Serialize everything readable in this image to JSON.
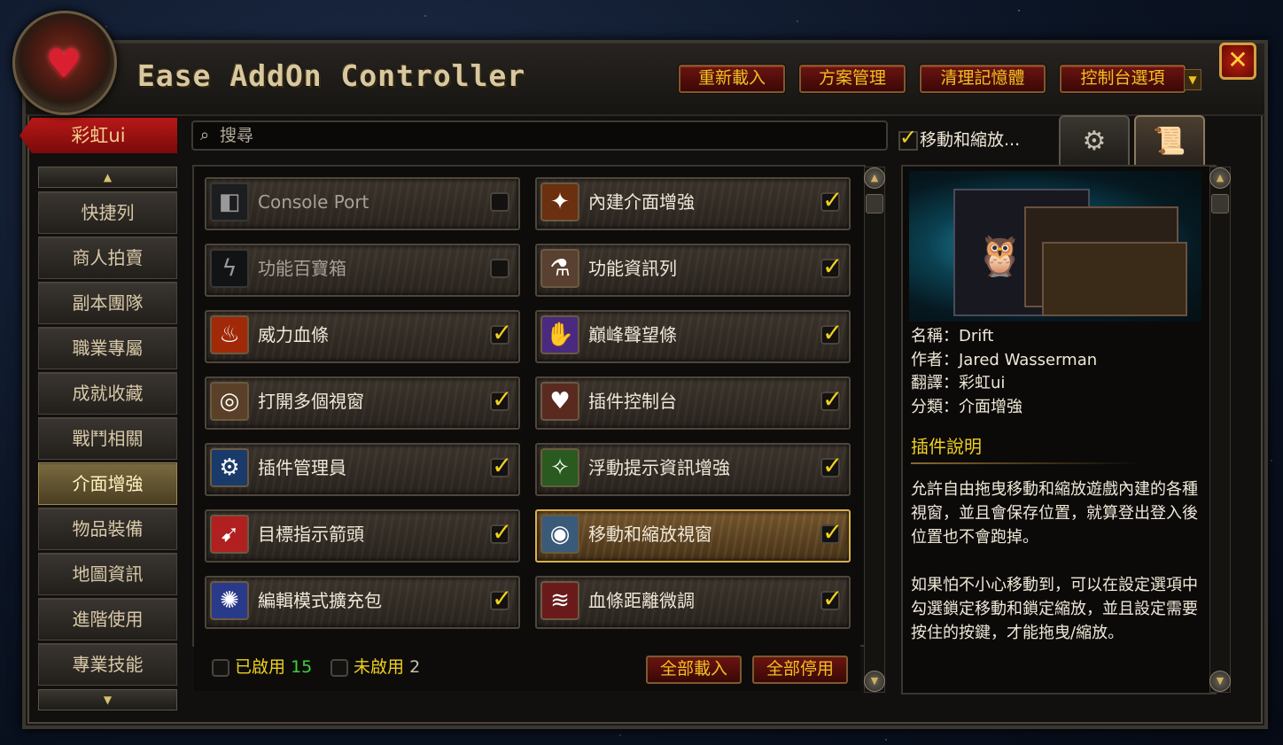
{
  "window": {
    "title": "Ease AddOn Controller"
  },
  "header": {
    "buttons": [
      "重新載入",
      "方案管理",
      "清理記憶體",
      "控制台選項"
    ],
    "close_label": "✕"
  },
  "sidebar": {
    "profile": "彩虹ui",
    "categories": [
      {
        "label": "快捷列",
        "active": false
      },
      {
        "label": "商人拍賣",
        "active": false
      },
      {
        "label": "副本團隊",
        "active": false
      },
      {
        "label": "職業專屬",
        "active": false
      },
      {
        "label": "成就收藏",
        "active": false
      },
      {
        "label": "戰鬥相關",
        "active": false
      },
      {
        "label": "介面增強",
        "active": true
      },
      {
        "label": "物品裝備",
        "active": false
      },
      {
        "label": "地圖資訊",
        "active": false
      },
      {
        "label": "進階使用",
        "active": false
      },
      {
        "label": "專業技能",
        "active": false
      }
    ]
  },
  "search": {
    "placeholder": "搜尋"
  },
  "addons": [
    {
      "label": "Console Port",
      "enabled": false,
      "icon": "console-port-icon"
    },
    {
      "label": "內建介面增強",
      "enabled": true,
      "icon": "blizzard-ui-icon"
    },
    {
      "label": "功能百寶箱",
      "enabled": false,
      "icon": "toolbox-icon"
    },
    {
      "label": "功能資訊列",
      "enabled": true,
      "icon": "info-bar-icon"
    },
    {
      "label": "威力血條",
      "enabled": true,
      "icon": "power-bar-icon"
    },
    {
      "label": "巔峰聲望條",
      "enabled": true,
      "icon": "reputation-icon"
    },
    {
      "label": "打開多個視窗",
      "enabled": true,
      "icon": "multi-window-icon"
    },
    {
      "label": "插件控制台",
      "enabled": true,
      "icon": "addon-control-icon"
    },
    {
      "label": "插件管理員",
      "enabled": true,
      "icon": "addon-manager-icon"
    },
    {
      "label": "浮動提示資訊增強",
      "enabled": true,
      "icon": "tooltip-icon"
    },
    {
      "label": "目標指示箭頭",
      "enabled": true,
      "icon": "target-arrow-icon"
    },
    {
      "label": "移動和縮放視窗",
      "enabled": true,
      "icon": "move-scale-icon",
      "selected": true
    },
    {
      "label": "編輯模式擴充包",
      "enabled": true,
      "icon": "edit-mode-icon"
    },
    {
      "label": "血條距離微調",
      "enabled": true,
      "icon": "nameplate-range-icon"
    }
  ],
  "footer": {
    "enabled_label": "已啟用",
    "enabled_count": "15",
    "disabled_label": "未啟用",
    "disabled_count": "2",
    "load_all": "全部載入",
    "disable_all": "全部停用"
  },
  "detail": {
    "move_scale_label": "移動和縮放...",
    "name_line": "名稱：Drift",
    "author_line": "作者：Jared Wasserman",
    "translator_line": "翻譯：彩虹ui",
    "category_line": "分類：介面增強",
    "section_title": "插件說明",
    "desc1": "允許自由拖曳移動和縮放遊戲內建的各種視窗，並且會保存位置，就算登出登入後位置也不會跑掉。",
    "desc2": "如果怕不小心移動到，可以在設定選項中勾選鎖定移動和鎖定縮放，並且設定需要按住的按鍵，才能拖曳/縮放。"
  },
  "colors": {
    "accent_gold": "#f0d020",
    "button_red": "#6a1410",
    "enabled_count": "#40d040"
  }
}
